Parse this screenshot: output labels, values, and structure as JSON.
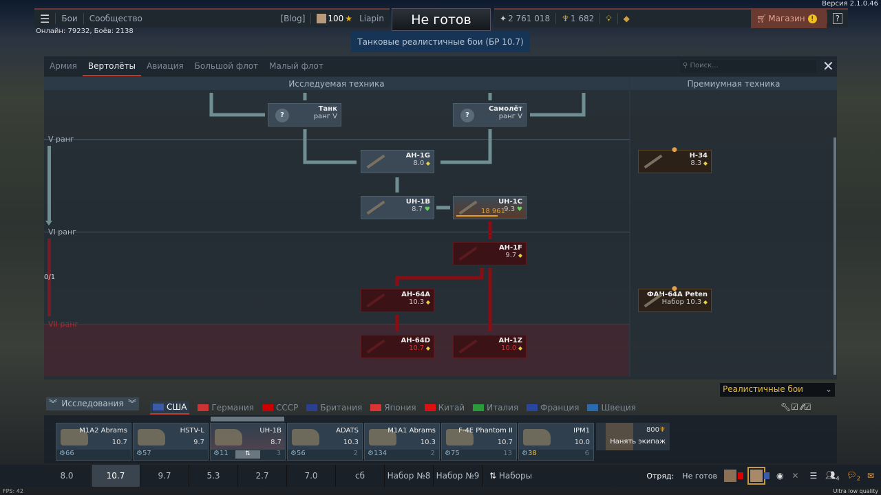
{
  "version": "Версия 2.1.0.46",
  "online": "Онлайн: 79232, Боёв: 2138",
  "topnav": {
    "battles": "Бои",
    "community": "Сообщество",
    "blog": "[Blog]",
    "level": "100",
    "username": "Liapin",
    "ready": "Не готов",
    "mode": "Танковые реалистичные бои (БР 10.7)",
    "silver_lions": "2 761 018",
    "golden_eagles": "1 682",
    "shop": "Магазин",
    "help": "?"
  },
  "window": {
    "tabs": [
      "Армия",
      "Вертолёты",
      "Авиация",
      "Большой флот",
      "Малый флот"
    ],
    "active_tab": 1,
    "search_placeholder": "Поиск...",
    "researched_header": "Исследуемая техника",
    "premium_header": "Премиумная техника",
    "ranks": [
      "V ранг",
      "VI ранг",
      "VII ранг"
    ],
    "rank_progress": "0/1",
    "nodes": [
      {
        "name": "Танк",
        "sub": "ранг V",
        "state": "unknown"
      },
      {
        "name": "Самолёт",
        "sub": "ранг V",
        "state": "unknown"
      },
      {
        "name": "AH-1G",
        "br": "8.0",
        "state": "owned"
      },
      {
        "name": "UH-1B",
        "br": "8.7",
        "state": "owned"
      },
      {
        "name": "UH-1C",
        "br": "9.3",
        "research_points": "18 961",
        "research_progress": 0.85,
        "state": "researching"
      },
      {
        "name": "AH-1F",
        "br": "9.7",
        "state": "locked"
      },
      {
        "name": "AH-64A",
        "br": "10.3",
        "state": "locked"
      },
      {
        "name": "AH-64D",
        "br": "10.7",
        "state": "locked"
      },
      {
        "name": "AH-1Z",
        "br": "10.0",
        "state": "locked"
      },
      {
        "name": "H-34",
        "br": "8.3",
        "state": "premium"
      },
      {
        "name": "ФAH-64A Peten",
        "br": "Набор 10.3",
        "state": "premium"
      }
    ],
    "game_mode": "Реалистичные бои"
  },
  "research_button": "Исследования",
  "countries": [
    "США",
    "Германия",
    "СССР",
    "Британия",
    "Япония",
    "Китай",
    "Италия",
    "Франция",
    "Швеция"
  ],
  "country_colors": [
    "#3b5aa8",
    "#c33",
    "#c00",
    "#2a3f8f",
    "#d33",
    "#d11",
    "#2a9a3a",
    "#2845a0",
    "#2a6ab0"
  ],
  "slots": [
    {
      "name": "M1A2 Abrams",
      "br": "10.7",
      "crew": "66"
    },
    {
      "name": "HSTV-L",
      "br": "9.7",
      "crew": "57"
    },
    {
      "name": "UH-1B",
      "br": "8.7",
      "crew": "11",
      "count": "3"
    },
    {
      "name": "ADATS",
      "br": "10.3",
      "crew": "56",
      "count": "2"
    },
    {
      "name": "M1A1 Abrams",
      "br": "10.3",
      "crew": "134",
      "count": "2"
    },
    {
      "name": "F-4E Phantom II",
      "br": "10.7",
      "crew": "75",
      "count": "13"
    },
    {
      "name": "IPM1",
      "br": "10.0",
      "crew": "38",
      "count": "6"
    }
  ],
  "hire_crew": {
    "cost": "800",
    "label": "Нанять экипаж"
  },
  "presets": [
    "8.0",
    "10.7",
    "9.7",
    "5.3",
    "2.7",
    "7.0",
    "сб",
    "Набор №8",
    "Набор №9"
  ],
  "active_preset": 1,
  "presets_button": "Наборы",
  "squad": {
    "label": "Отряд:",
    "status": "Не готов",
    "friends_count": "4",
    "chat_count": "2"
  },
  "fps": "FPS: 42",
  "quality": "Ultra low quality"
}
